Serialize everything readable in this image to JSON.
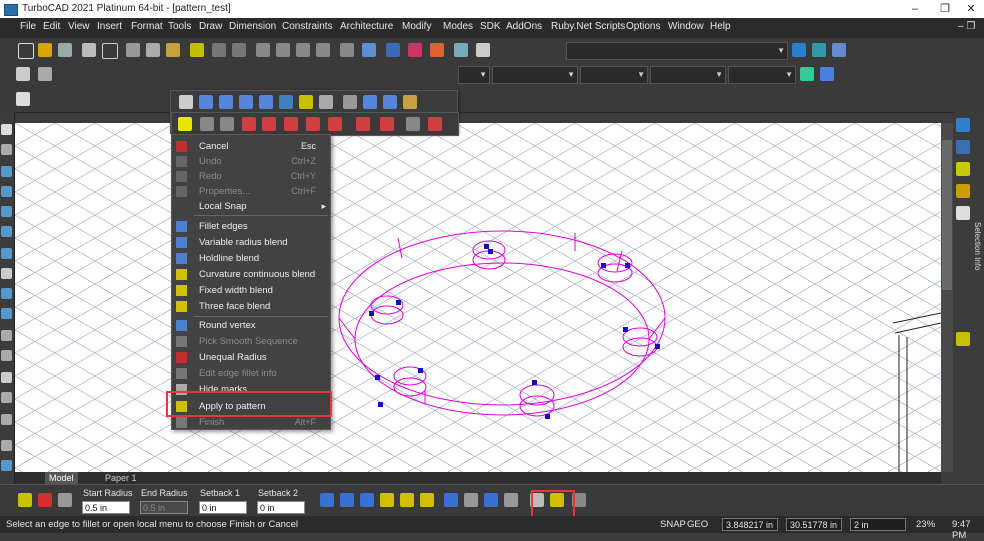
{
  "window": {
    "title": "TurboCAD 2021 Platinum 64-bit - [pattern_test]",
    "minimize": "–",
    "restore": "❐",
    "close": "✕"
  },
  "menubar": {
    "items": [
      "File",
      "Edit",
      "View",
      "Insert",
      "Format",
      "Tools",
      "Draw",
      "Dimension",
      "Constraints",
      "Architecture",
      "Modify",
      "Modes",
      "SDK",
      "AddOns",
      "Ruby.Net Scripts",
      "Options",
      "Window",
      "Help"
    ],
    "doc_controls": "– ❐"
  },
  "context_menu": {
    "items": [
      {
        "label": "Cancel",
        "shortcut": "Esc",
        "enabled": true
      },
      {
        "label": "Undo",
        "shortcut": "Ctrl+Z",
        "enabled": false
      },
      {
        "label": "Redo",
        "shortcut": "Ctrl+Y",
        "enabled": false
      },
      {
        "label": "Properties...",
        "shortcut": "Ctrl+F",
        "enabled": false
      },
      {
        "label": "Local Snap",
        "shortcut": "",
        "enabled": true,
        "submenu_arrow": "▸"
      },
      {
        "label": "Fillet edges",
        "shortcut": "",
        "enabled": true
      },
      {
        "label": "Variable radius blend",
        "shortcut": "",
        "enabled": true
      },
      {
        "label": "Holdline blend",
        "shortcut": "",
        "enabled": true
      },
      {
        "label": "Curvature continuous blend",
        "shortcut": "",
        "enabled": true
      },
      {
        "label": "Fixed width blend",
        "shortcut": "",
        "enabled": true
      },
      {
        "label": "Three face blend",
        "shortcut": "",
        "enabled": true
      },
      {
        "label": "Round vertex",
        "shortcut": "",
        "enabled": true
      },
      {
        "label": "Pick Smooth Sequence",
        "shortcut": "",
        "enabled": false
      },
      {
        "label": "Unequal Radius",
        "shortcut": "",
        "enabled": true
      },
      {
        "label": "Edit edge fillet info",
        "shortcut": "",
        "enabled": false
      },
      {
        "label": "Hide marks",
        "shortcut": "",
        "enabled": true
      },
      {
        "label": "Apply to pattern",
        "shortcut": "",
        "enabled": true
      },
      {
        "label": "Finish",
        "shortcut": "Alt+F",
        "enabled": false
      }
    ]
  },
  "tabs": {
    "model": "Model",
    "paper": "Paper 1"
  },
  "right_panel": {
    "label": "Selection Info"
  },
  "inspector": {
    "fields": [
      {
        "label": "Start Radius",
        "value": "0.5 in",
        "enabled": true
      },
      {
        "label": "End Radius",
        "value": "0.5 in",
        "enabled": false
      },
      {
        "label": "Setback 1",
        "value": "0 in",
        "enabled": true
      },
      {
        "label": "Setback 2",
        "value": "0 in",
        "enabled": true
      }
    ]
  },
  "statusbar": {
    "message": "Select an edge to fillet or open local menu to choose Finish or Cancel",
    "snap": "SNAP",
    "geo": "GEO",
    "x": "3.848217 in",
    "y": "30.51778 in",
    "z": "2 in",
    "zoom": "23%",
    "time": "9:47 PM"
  },
  "colors": {
    "highlight": "#e03a3a",
    "geometry": "#e000e0",
    "grips": "#1010c0"
  }
}
